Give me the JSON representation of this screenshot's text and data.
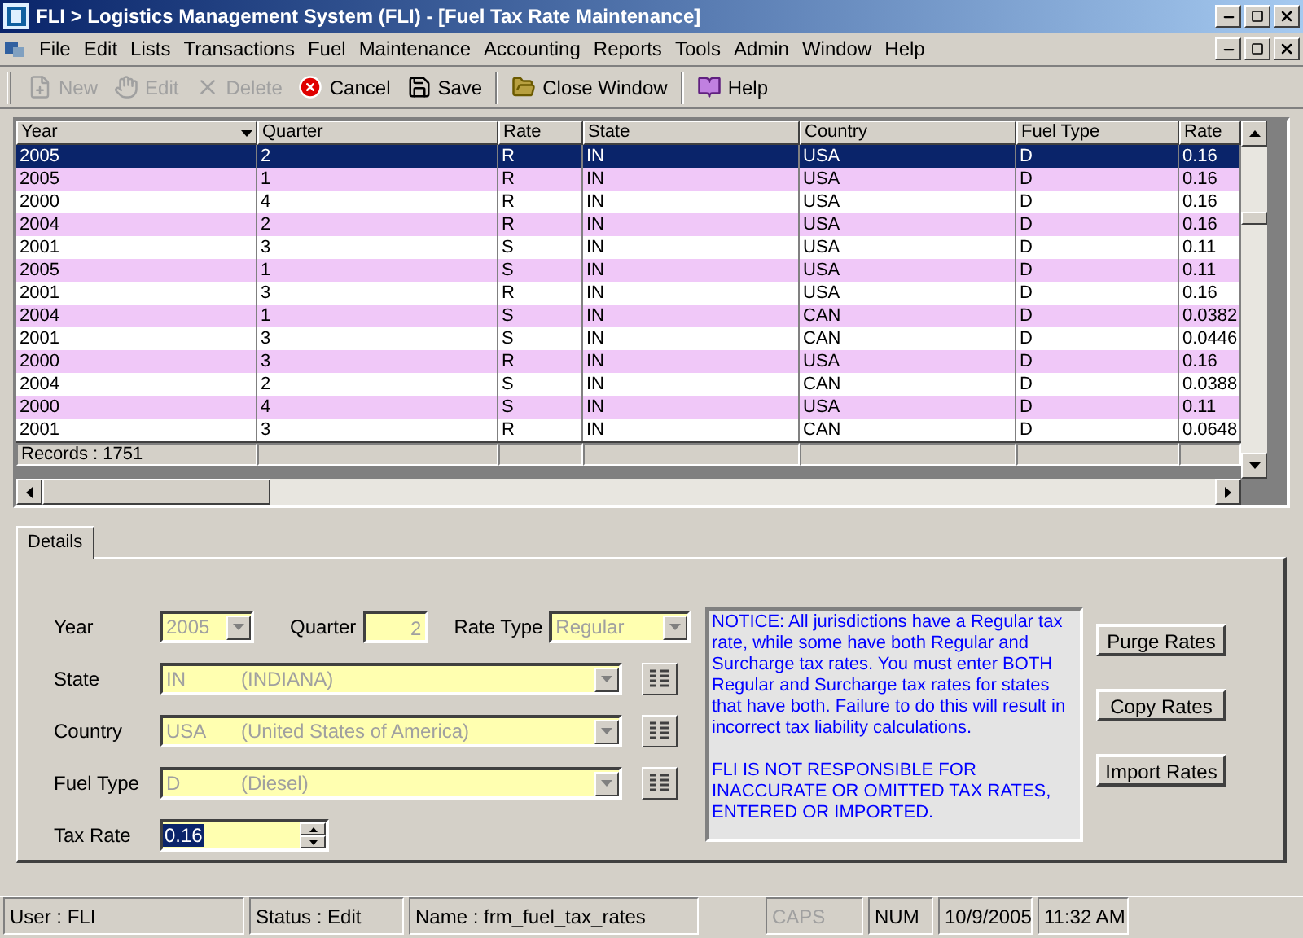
{
  "window": {
    "title": "FLI > Logistics Management System (FLI) - [Fuel Tax Rate Maintenance]"
  },
  "menu": [
    "File",
    "Edit",
    "Lists",
    "Transactions",
    "Fuel",
    "Maintenance",
    "Accounting",
    "Reports",
    "Tools",
    "Admin",
    "Window",
    "Help"
  ],
  "toolbar": [
    {
      "label": "New",
      "disabled": true
    },
    {
      "label": "Edit",
      "disabled": true
    },
    {
      "label": "Delete",
      "disabled": true
    },
    {
      "label": "Cancel",
      "disabled": false
    },
    {
      "label": "Save",
      "disabled": false
    },
    {
      "label": "Close Window",
      "disabled": false
    },
    {
      "label": "Help",
      "disabled": false
    }
  ],
  "table": {
    "columns": [
      "Year",
      "Quarter",
      "Rate",
      "State",
      "Country",
      "Fuel Type",
      "Rate"
    ],
    "rows": [
      {
        "cells": [
          "2005",
          "2",
          "R",
          "IN",
          "USA",
          "D",
          "0.16"
        ],
        "selected": true
      },
      {
        "cells": [
          "2005",
          "1",
          "R",
          "IN",
          "USA",
          "D",
          "0.16"
        ],
        "selected": false
      },
      {
        "cells": [
          "2000",
          "4",
          "R",
          "IN",
          "USA",
          "D",
          "0.16"
        ],
        "selected": false
      },
      {
        "cells": [
          "2004",
          "2",
          "R",
          "IN",
          "USA",
          "D",
          "0.16"
        ],
        "selected": false
      },
      {
        "cells": [
          "2001",
          "3",
          "S",
          "IN",
          "USA",
          "D",
          "0.11"
        ],
        "selected": false
      },
      {
        "cells": [
          "2005",
          "1",
          "S",
          "IN",
          "USA",
          "D",
          "0.11"
        ],
        "selected": false
      },
      {
        "cells": [
          "2001",
          "3",
          "R",
          "IN",
          "USA",
          "D",
          "0.16"
        ],
        "selected": false
      },
      {
        "cells": [
          "2004",
          "1",
          "S",
          "IN",
          "CAN",
          "D",
          "0.0382"
        ],
        "selected": false
      },
      {
        "cells": [
          "2001",
          "3",
          "S",
          "IN",
          "CAN",
          "D",
          "0.0446"
        ],
        "selected": false
      },
      {
        "cells": [
          "2000",
          "3",
          "R",
          "IN",
          "USA",
          "D",
          "0.16"
        ],
        "selected": false
      },
      {
        "cells": [
          "2004",
          "2",
          "S",
          "IN",
          "CAN",
          "D",
          "0.0388"
        ],
        "selected": false
      },
      {
        "cells": [
          "2000",
          "4",
          "S",
          "IN",
          "USA",
          "D",
          "0.11"
        ],
        "selected": false
      },
      {
        "cells": [
          "2001",
          "3",
          "R",
          "IN",
          "CAN",
          "D",
          "0.0648"
        ],
        "selected": false
      }
    ],
    "footer": "Records : 1751"
  },
  "tabs": [
    {
      "label": "Details",
      "selected": true
    }
  ],
  "details": {
    "year": {
      "label": "Year",
      "value": "2005",
      "disabled": true
    },
    "quarter": {
      "label": "Quarter",
      "value": "2",
      "disabled": true
    },
    "rate_type": {
      "label": "Rate Type",
      "value": "Regular",
      "disabled": true
    },
    "fields": [
      {
        "label": "State",
        "code": "IN",
        "name": "(INDIANA)",
        "disabled": true
      },
      {
        "label": "Country",
        "code": "USA",
        "name": "(United States of America)",
        "disabled": true
      },
      {
        "label": "Fuel Type",
        "code": "D",
        "name": "(Diesel)",
        "disabled": true
      }
    ],
    "tax_rate": {
      "label": "Tax Rate",
      "value": "0.16"
    },
    "notice": [
      "NOTICE: All jurisdictions have a Regular tax rate, while some have both Regular and Surcharge tax rates.  You must enter BOTH Regular and Surcharge tax rates for states that have both.  Failure to do this will result in incorrect tax liability calculations.",
      "FLI IS NOT RESPONSIBLE FOR INACCURATE OR OMITTED TAX RATES, ENTERED OR IMPORTED."
    ],
    "buttons": [
      "Purge Rates",
      "Copy Rates",
      "Import Rates"
    ]
  },
  "status_bar": [
    {
      "text": "User : FLI",
      "disabled": false
    },
    {
      "text": "Status : Edit",
      "disabled": false
    },
    {
      "text": "Name : frm_fuel_tax_rates",
      "disabled": false
    },
    {
      "text": "CAPS",
      "disabled": true
    },
    {
      "text": "NUM",
      "disabled": false
    },
    {
      "text": "10/9/2005",
      "disabled": false
    },
    {
      "text": "11:32 AM",
      "disabled": false
    }
  ]
}
